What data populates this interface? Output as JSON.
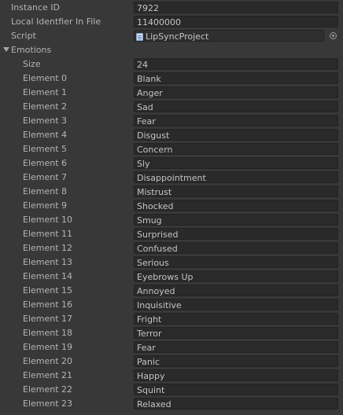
{
  "inspector": {
    "instance_id_label": "Instance ID",
    "instance_id_value": "7922",
    "local_id_label": "Local Identfier In File",
    "local_id_value": "11400000",
    "script_label": "Script",
    "script_value": "LipSyncProject",
    "script_icon": "script-file-icon",
    "picker_icon": "object-picker-icon",
    "foldout_icon": "triangle-down-icon",
    "emotions_label": "Emotions",
    "size_label": "Size",
    "size_value": "24"
  },
  "emotions": [
    {
      "label": "Element 0",
      "value": "Blank"
    },
    {
      "label": "Element 1",
      "value": "Anger"
    },
    {
      "label": "Element 2",
      "value": "Sad"
    },
    {
      "label": "Element 3",
      "value": "Fear"
    },
    {
      "label": "Element 4",
      "value": "Disgust"
    },
    {
      "label": "Element 5",
      "value": "Concern"
    },
    {
      "label": "Element 6",
      "value": "Sly"
    },
    {
      "label": "Element 7",
      "value": "Disappointment"
    },
    {
      "label": "Element 8",
      "value": "Mistrust"
    },
    {
      "label": "Element 9",
      "value": "Shocked"
    },
    {
      "label": "Element 10",
      "value": "Smug"
    },
    {
      "label": "Element 11",
      "value": "Surprised"
    },
    {
      "label": "Element 12",
      "value": "Confused"
    },
    {
      "label": "Element 13",
      "value": "Serious"
    },
    {
      "label": "Element 14",
      "value": "Eyebrows Up"
    },
    {
      "label": "Element 15",
      "value": "Annoyed"
    },
    {
      "label": "Element 16",
      "value": "Inquisitive"
    },
    {
      "label": "Element 17",
      "value": "Fright"
    },
    {
      "label": "Element 18",
      "value": "Terror"
    },
    {
      "label": "Element 19",
      "value": "Fear"
    },
    {
      "label": "Element 20",
      "value": "Panic"
    },
    {
      "label": "Element 21",
      "value": "Happy"
    },
    {
      "label": "Element 22",
      "value": "Squint"
    },
    {
      "label": "Element 23",
      "value": "Relaxed"
    }
  ]
}
